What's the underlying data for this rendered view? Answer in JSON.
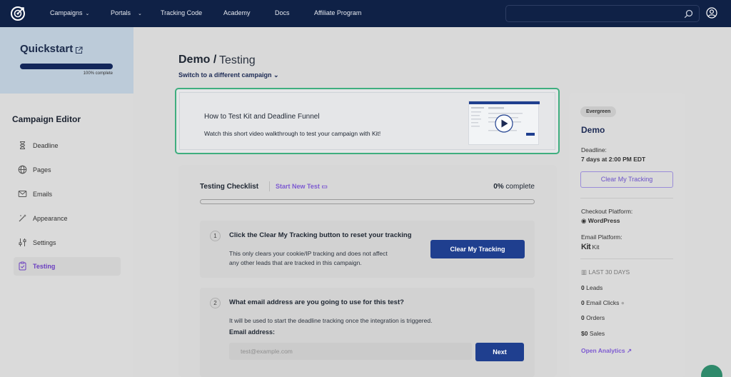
{
  "nav": {
    "items": [
      {
        "label": "Campaigns",
        "dropdown": true
      },
      {
        "label": "Portals",
        "dropdown": true
      },
      {
        "label": "Tracking Code",
        "dropdown": false
      },
      {
        "label": "Academy",
        "dropdown": false
      },
      {
        "label": "Docs",
        "dropdown": false
      },
      {
        "label": "Affiliate Program",
        "dropdown": false
      }
    ],
    "search_placeholder": ""
  },
  "sidebar": {
    "quickstart_title": "Quickstart",
    "progress_percent": 100,
    "progress_label": "100% complete",
    "editor_title": "Campaign Editor",
    "items": [
      {
        "label": "Deadline",
        "icon": "hourglass-icon",
        "active": false
      },
      {
        "label": "Pages",
        "icon": "globe-icon",
        "active": false
      },
      {
        "label": "Emails",
        "icon": "mail-icon",
        "active": false
      },
      {
        "label": "Appearance",
        "icon": "magic-wand-icon",
        "active": false
      },
      {
        "label": "Settings",
        "icon": "sliders-icon",
        "active": false
      },
      {
        "label": "Testing",
        "icon": "clipboard-check-icon",
        "active": true
      }
    ]
  },
  "header": {
    "campaign": "Demo /",
    "page": "Testing",
    "switch_label": "Switch to a different campaign"
  },
  "video": {
    "title": "How to Test Kit and Deadline Funnel",
    "subtitle": "Watch this short video walkthrough to test your campaign with Kit!"
  },
  "checklist": {
    "title": "Testing Checklist",
    "new_test_label": "Start New Test",
    "percent_value": "0%",
    "percent_suffix": "complete",
    "progress_percent": 0,
    "step1": {
      "num": "1",
      "heading": "Click the Clear My Tracking button to reset your tracking",
      "line1": "This only clears your cookie/IP tracking and does not affect",
      "line2": "any other leads that are tracked in this campaign.",
      "button": "Clear My Tracking"
    },
    "step2": {
      "num": "2",
      "heading": "What email address are you going to use for this test?",
      "text": "It will be used to start the deadline tracking once the integration is triggered.",
      "email_label": "Email address:",
      "email_placeholder": "test@example.com",
      "button": "Next"
    }
  },
  "panel": {
    "badge": "Evergreen",
    "title": "Demo",
    "deadline_label": "Deadline:",
    "deadline_value": "7 days at 2:00 PM EDT",
    "clear_button": "Clear My Tracking",
    "checkout_label": "Checkout Platform:",
    "checkout_value": "WordPress",
    "email_label": "Email Platform:",
    "email_logo": "Kit",
    "email_value": "Kit",
    "period": "LAST 30 DAYS",
    "stats": [
      {
        "value": "0",
        "label": "Leads"
      },
      {
        "value": "0",
        "label": "Email Clicks"
      },
      {
        "value": "0",
        "label": "Orders"
      },
      {
        "value": "$0",
        "label": "Sales"
      }
    ],
    "analytics_link": "Open Analytics"
  }
}
